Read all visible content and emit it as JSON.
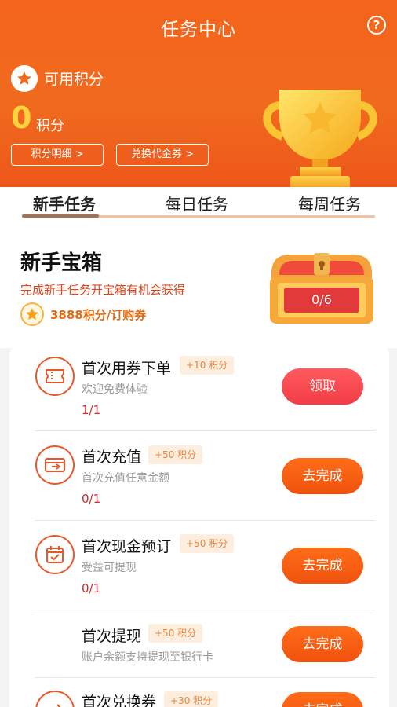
{
  "header": {
    "title": "任务中心",
    "help_icon": "question-circle-icon",
    "points_label": "可用积分",
    "points_value": "0",
    "points_unit": "积分",
    "detail_button": "积分明细 >",
    "exchange_button": "兑换代金券 >"
  },
  "tabs": [
    {
      "label": "新手任务"
    },
    {
      "label": "每日任务"
    },
    {
      "label": "每周任务"
    }
  ],
  "treasure": {
    "title": "新手宝箱",
    "subtitle": "完成新手任务开宝箱有机会获得",
    "reward": "3888积分/订购券",
    "progress": "0/6"
  },
  "tasks": [
    {
      "title": "首次用券下单",
      "tag": "+10 积分",
      "desc": "欢迎免费体验",
      "progress": "1/1",
      "button": "领取",
      "icon": "coupon-icon"
    },
    {
      "title": "首次充值",
      "tag": "+50 积分",
      "desc": "首次充值任意金额",
      "progress": "0/1",
      "button": "去完成",
      "icon": "wallet-icon"
    },
    {
      "title": "首次现金预订",
      "tag": "+50 积分",
      "desc": "受益可提现",
      "progress": "0/1",
      "button": "去完成",
      "icon": "calendar-check-icon"
    },
    {
      "title": "首次提现",
      "tag": "+50 积分",
      "desc": "账户余额支持提现至银行卡",
      "progress": "",
      "button": "去完成",
      "icon": ""
    },
    {
      "title": "首次兑换券",
      "tag": "+30 积分",
      "desc": "",
      "progress": "",
      "button": "去完成",
      "icon": "exchange-icon"
    }
  ],
  "colors": {
    "header_orange": "#f06a1e",
    "points_yellow": "#ffd23e",
    "claim_red": "#f23d46",
    "go_orange": "#f0520e",
    "progress_red": "#d42b2b"
  }
}
